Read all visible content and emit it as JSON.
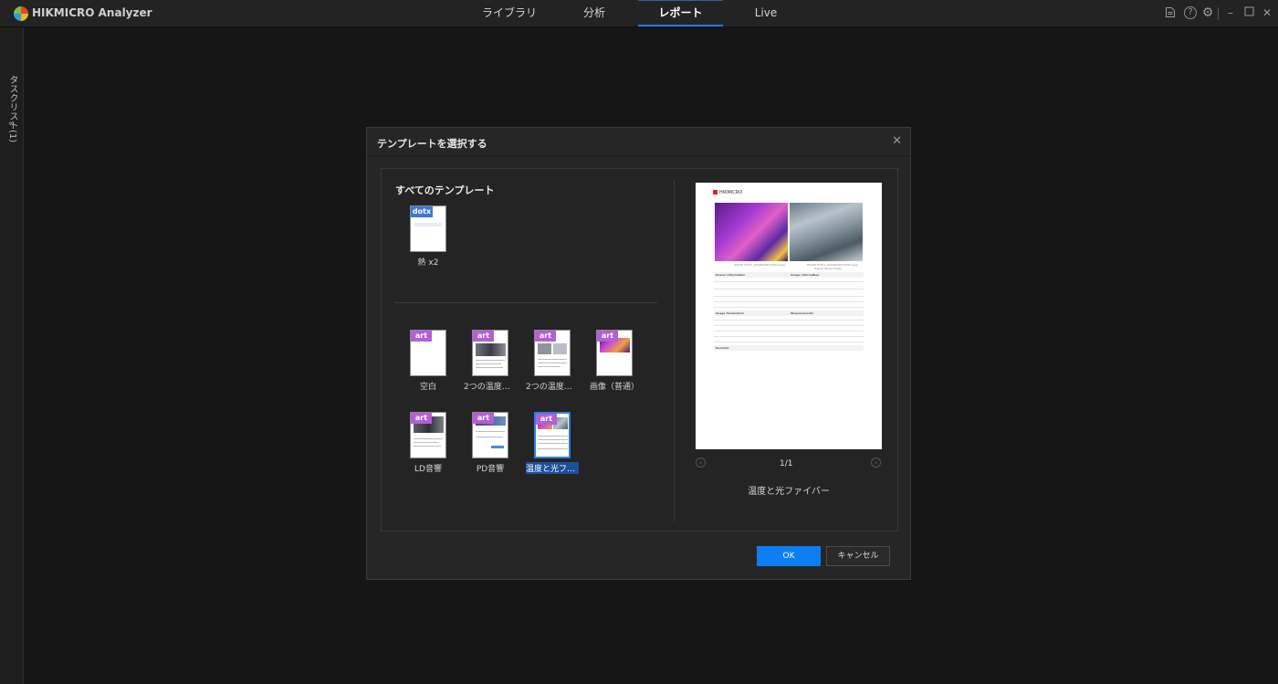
{
  "app": {
    "title": "HIKMICRO Analyzer"
  },
  "nav": {
    "tabs": [
      "ライブラリ",
      "分析",
      "レポート",
      "Live"
    ],
    "active": "レポート"
  },
  "side_panel": {
    "label": "タスクリスト(1)",
    "chevron": "«"
  },
  "dialog": {
    "title": "テンプレートを選択する",
    "close": "✕",
    "section_title": "すべてのテンプレート",
    "user_templates": [
      {
        "badge": "dotx",
        "label": "熱 x2"
      }
    ],
    "builtin_templates": [
      {
        "badge": "art",
        "label": "空白"
      },
      {
        "badge": "art",
        "label": "2つの温度一..."
      },
      {
        "badge": "art",
        "label": "2つの温度比..."
      },
      {
        "badge": "art",
        "label": "画像（普通）"
      },
      {
        "badge": "art",
        "label": "LD音響"
      },
      {
        "badge": "art",
        "label": "PD音響"
      },
      {
        "badge": "art",
        "label": "温度と光ファイ...",
        "selected": true
      }
    ],
    "preview": {
      "page": "1/1",
      "name": "温度と光ファイバー",
      "logo": "HIKMICRO",
      "caption_left": "HM20170701_20220918154322.jpeg",
      "caption_right": "HM20170701_20220918154322.jpeg",
      "caption_right2": "Digital Visual Image",
      "sections": {
        "device": "Device Information",
        "image": "Image Information",
        "params": "Image Parameters",
        "measure": "Measurements",
        "remarks": "Remarks"
      }
    },
    "buttons": {
      "ok": "OK",
      "cancel": "キャンセル"
    }
  },
  "colors": {
    "accent": "#0d7ef2",
    "art_badge": "#b45fd6",
    "dotx_badge": "#3c78d8"
  }
}
